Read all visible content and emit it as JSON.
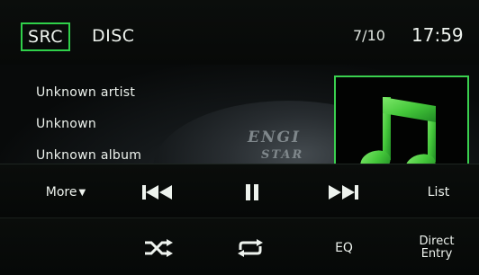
{
  "header": {
    "source_button_label": "SRC",
    "source_name": "DISC",
    "track_counter": "7/10",
    "clock": "17:59"
  },
  "track_info": {
    "artist": "Unknown artist",
    "title": "Unknown",
    "album": "Unknown album"
  },
  "background_emblem": {
    "line1": "ENGI",
    "line2": "STAR"
  },
  "controls": {
    "more_label": "More",
    "more_arrow": "▼",
    "list_label": "List",
    "eq_label": "EQ",
    "direct_entry_line1": "Direct",
    "direct_entry_line2": "Entry"
  },
  "icons": {
    "prev": "previous-track-icon",
    "pause": "pause-icon",
    "next": "next-track-icon",
    "shuffle": "shuffle-icon",
    "repeat": "repeat-icon",
    "album_art": "music-note-icon"
  },
  "colors": {
    "accent_green": "#2fd14a",
    "note_green": "#4ccd3c",
    "text": "#eef3ee",
    "background": "#050706"
  }
}
